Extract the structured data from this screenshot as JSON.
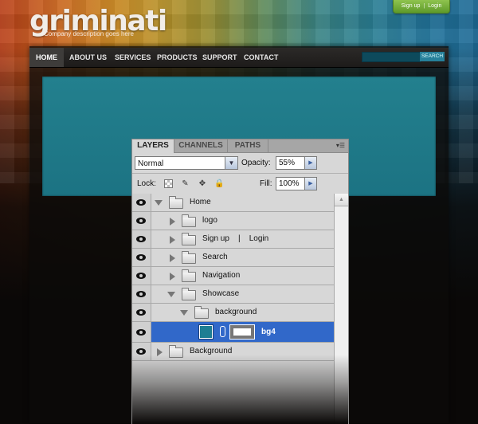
{
  "site": {
    "logo": "griminati",
    "tagline": "Company description goes here",
    "auth": {
      "signup": "Sign up",
      "separator": "|",
      "login": "Login"
    },
    "nav": [
      {
        "label": "HOME",
        "active": true
      },
      {
        "label": "ABOUT US",
        "active": false
      },
      {
        "label": "SERVICES",
        "active": false
      },
      {
        "label": "PRODUCTS",
        "active": false
      },
      {
        "label": "SUPPORT",
        "active": false
      },
      {
        "label": "CONTACT",
        "active": false
      }
    ],
    "search_button": "SEARCH",
    "colors": {
      "showcase": "#1f7a8a",
      "nav_bg": "#242220",
      "auth_green": "#76b03c"
    }
  },
  "layers_panel": {
    "tabs": [
      {
        "label": "LAYERS",
        "active": true
      },
      {
        "label": "CHANNELS",
        "active": false
      },
      {
        "label": "PATHS",
        "active": false
      }
    ],
    "menu_icon": "panel-menu-icon",
    "blend_mode": "Normal",
    "opacity_label": "Opacity:",
    "opacity_value": "55%",
    "lock_label": "Lock:",
    "fill_label": "Fill:",
    "fill_value": "100%",
    "selection_color": "#3168c9",
    "layers": [
      {
        "name": "Home",
        "depth": 0,
        "expanded": true,
        "type": "group",
        "selected": false
      },
      {
        "name": "logo",
        "depth": 1,
        "expanded": false,
        "type": "group",
        "selected": false
      },
      {
        "name": "Sign up    |    Login",
        "depth": 1,
        "expanded": false,
        "type": "group",
        "selected": false
      },
      {
        "name": "Search",
        "depth": 1,
        "expanded": false,
        "type": "group",
        "selected": false
      },
      {
        "name": "Navigation",
        "depth": 1,
        "expanded": false,
        "type": "group",
        "selected": false
      },
      {
        "name": "Showcase",
        "depth": 1,
        "expanded": true,
        "type": "group",
        "selected": false
      },
      {
        "name": "background",
        "depth": 2,
        "expanded": true,
        "type": "group",
        "selected": false
      },
      {
        "name": "bg4",
        "depth": 3,
        "type": "layer",
        "selected": true
      },
      {
        "name": "Background",
        "depth": 0,
        "expanded": false,
        "type": "group",
        "selected": false
      }
    ]
  }
}
